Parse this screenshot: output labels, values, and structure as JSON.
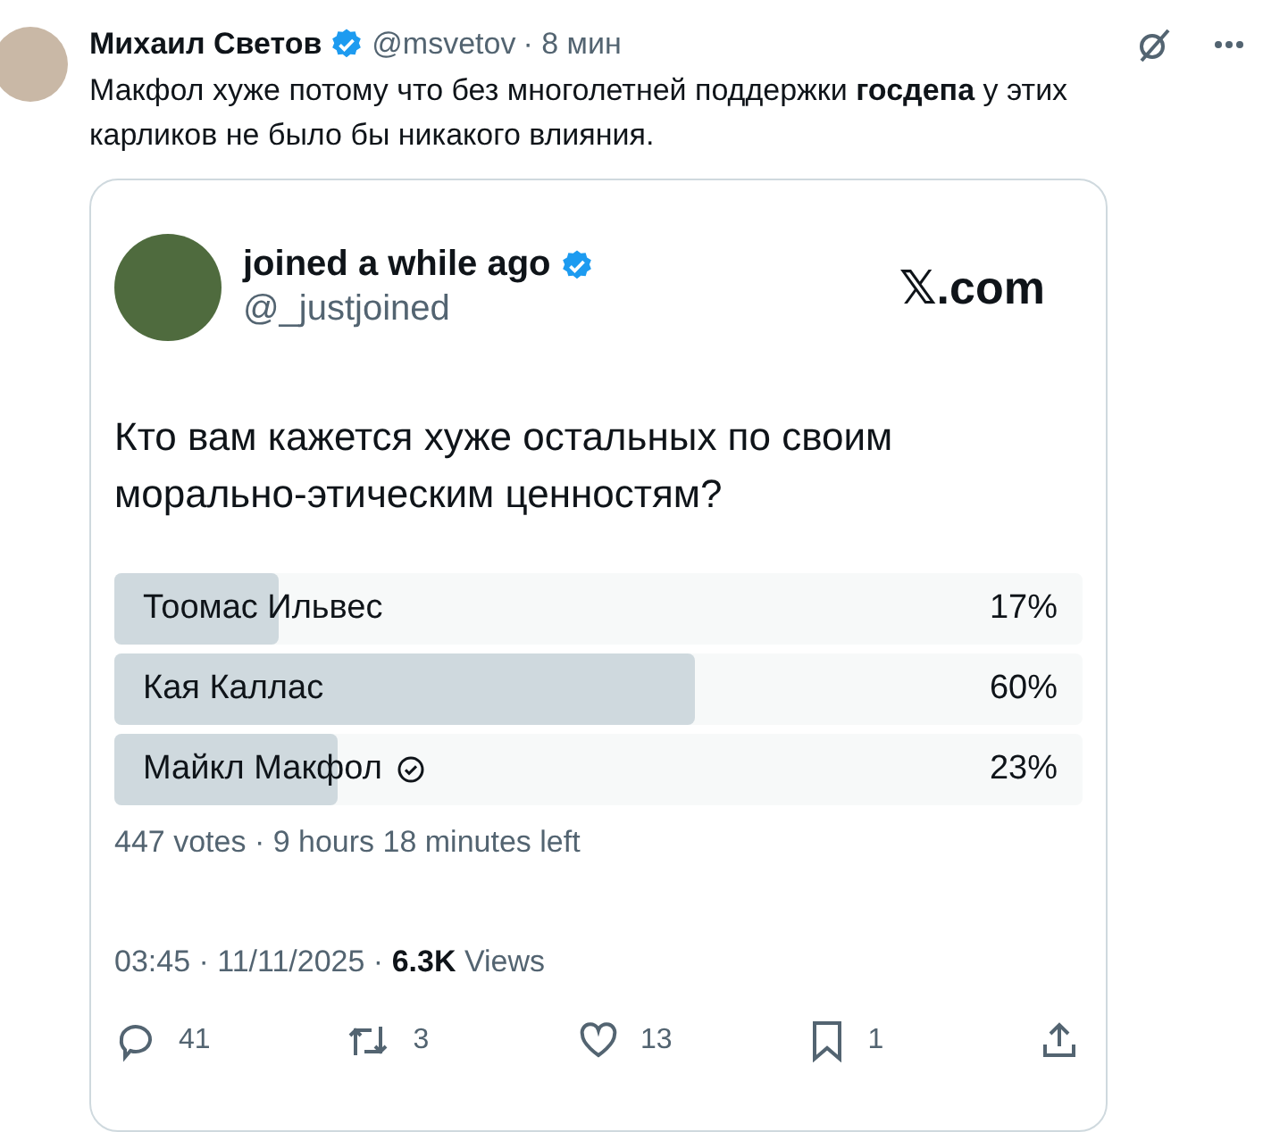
{
  "reply": {
    "name": "Михаил Светов",
    "verified": true,
    "handle": "@msvetov",
    "time": "· 8 мин",
    "text": "Макфол хуже потому что без многолетней поддержки **госдепа** у этих карликов не было бы никакого влияния."
  },
  "quoted_post": {
    "name": "joined a while ago",
    "verified": true,
    "handle": "@_justjoined",
    "site": "𝕏.com",
    "question": "Кто вам кажется хуже остальных по своим морально-этическим ценностям?",
    "poll": [
      {
        "label": "Тоомас Ильвес",
        "percent": "17%",
        "level": 0.17,
        "selected": false
      },
      {
        "label": "Кая Каллас",
        "percent": "60%",
        "level": 0.6,
        "selected": false
      },
      {
        "label": "Майкл Макфол",
        "percent": "23%",
        "level": 0.23,
        "selected": true
      }
    ],
    "poll_info": "447 votes · 9 hours 18 minutes left",
    "timestamp": "03:45 · 11/11/2025 · ",
    "views_count": "6.3K",
    "views_label": "Views",
    "actions": [
      {
        "kind": "reply",
        "count": "41"
      },
      {
        "kind": "repost",
        "count": "3"
      },
      {
        "kind": "like",
        "count": "13"
      },
      {
        "kind": "bookmark",
        "count": "1"
      },
      {
        "kind": "share"
      }
    ]
  }
}
